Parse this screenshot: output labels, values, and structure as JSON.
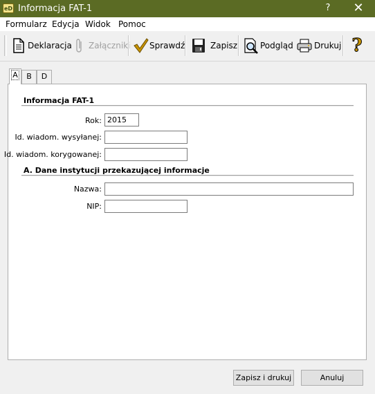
{
  "window": {
    "title": "Informacja FAT-1",
    "icon_text": "eD",
    "help_glyph": "?",
    "close_glyph": "✕"
  },
  "menubar": {
    "items": [
      {
        "label": "Formularz"
      },
      {
        "label": "Edycja"
      },
      {
        "label": "Widok"
      },
      {
        "label": "Pomoc"
      }
    ]
  },
  "toolbar": {
    "deklaracja": {
      "label": "Deklaracja",
      "icon": "document-icon"
    },
    "zalaczniki": {
      "label": "Załączniki",
      "icon": "paperclip-icon",
      "disabled": true
    },
    "sprawdz": {
      "label": "Sprawdź",
      "icon": "checkmark-icon"
    },
    "zapisz": {
      "label": "Zapisz",
      "icon": "floppy-disk-icon"
    },
    "podglad": {
      "label": "Podgląd",
      "icon": "magnifier-icon"
    },
    "drukuj": {
      "label": "Drukuj",
      "icon": "printer-icon"
    },
    "help": {
      "label": "?",
      "icon": "question-mark-icon"
    }
  },
  "tabs": [
    {
      "label": "A",
      "active": true
    },
    {
      "label": "B",
      "active": false
    },
    {
      "label": "D",
      "active": false
    }
  ],
  "form": {
    "section1_title": "Informacja FAT-1",
    "rok": {
      "label": "Rok:",
      "value": "2015"
    },
    "id_wyslanej": {
      "label": "Id. wiadom. wysyłanej:",
      "value": ""
    },
    "id_korygowanej": {
      "label": "Id. wiadom. korygowanej:",
      "value": ""
    },
    "section2_title": "A. Dane instytucji przekazującej informacje",
    "nazwa": {
      "label": "Nazwa:",
      "value": ""
    },
    "nip": {
      "label": "NIP:",
      "value": ""
    }
  },
  "buttons": {
    "save_print": "Zapisz i drukuj",
    "cancel": "Anuluj"
  },
  "colors": {
    "titlebar": "#5b6b24",
    "checkmark": "#b88a00",
    "help": "#c89400"
  }
}
